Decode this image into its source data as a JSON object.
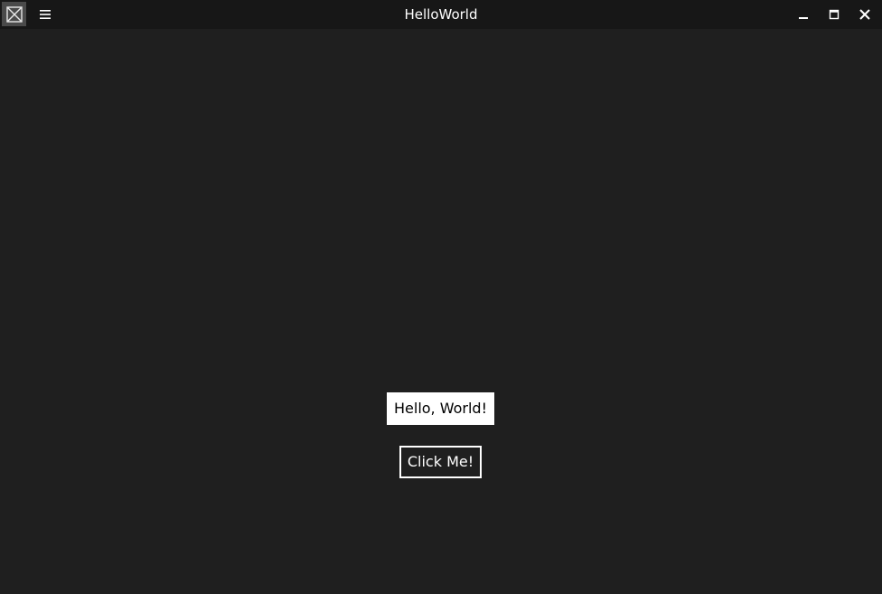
{
  "window": {
    "title": "HelloWorld",
    "app_icon": "app-logo-icon",
    "menu_icon": "hamburger-menu-icon",
    "caption_buttons": [
      "minimize-icon",
      "maximize-icon",
      "close-icon"
    ]
  },
  "main": {
    "hello_label": "Hello, World!",
    "click_button_label": "Click Me!"
  },
  "colors": {
    "background": "#1f1f1f",
    "titlebar": "#171717",
    "accent_label_bg": "#ffffff",
    "text_light": "#ffffff",
    "text_dark": "#000000"
  }
}
